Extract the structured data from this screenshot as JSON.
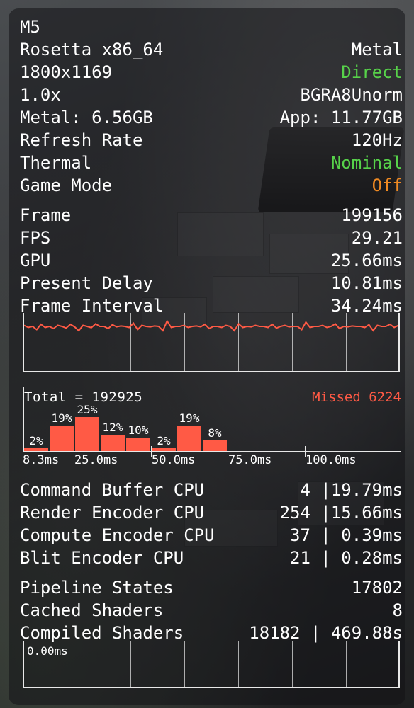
{
  "hud": {
    "device": "M5",
    "translation": "Rosetta x86_64",
    "api": "Metal",
    "resolution": "1800x1169",
    "display_mode": "Direct",
    "scale": "1.0x",
    "pixel_format": "BGRA8Unorm",
    "metal_memory": "Metal: 6.56GB",
    "app_memory": "App: 11.77GB",
    "refresh_label": "Refresh Rate",
    "refresh_value": "120Hz",
    "thermal_label": "Thermal",
    "thermal_value": "Nominal",
    "game_mode_label": "Game Mode",
    "game_mode_value": "Off"
  },
  "stats": {
    "frame_label": "Frame",
    "frame_value": "199156",
    "fps_label": "FPS",
    "fps_value": "29.21",
    "gpu_label": "GPU",
    "gpu_value": "25.66ms",
    "present_label": "Present Delay",
    "present_value": "10.81ms",
    "interval_label": "Frame Interval",
    "interval_value": "34.24ms"
  },
  "histogram": {
    "total": "Total = 192925",
    "missed": "Missed 6224",
    "bars": [
      {
        "label": "2%",
        "value": 2
      },
      {
        "label": "19%",
        "value": 19
      },
      {
        "label": "25%",
        "value": 25
      },
      {
        "label": "12%",
        "value": 12
      },
      {
        "label": "10%",
        "value": 10
      },
      {
        "label": "2%",
        "value": 2
      },
      {
        "label": "19%",
        "value": 19
      },
      {
        "label": "8%",
        "value": 8
      }
    ],
    "ticks": [
      "8.3ms",
      "25.0ms",
      "50.0ms",
      "75.0ms",
      "100.0ms"
    ]
  },
  "encoders": [
    {
      "name": "Command Buffer CPU",
      "count": "4",
      "sep": "|",
      "time": "19.79ms"
    },
    {
      "name": "Render Encoder CPU",
      "count": "254",
      "sep": "|",
      "time": "15.66ms"
    },
    {
      "name": "Compute Encoder CPU",
      "count": "37",
      "sep": "|",
      "time": " 0.39ms"
    },
    {
      "name": "Blit Encoder CPU",
      "count": "21",
      "sep": "|",
      "time": " 0.28ms"
    }
  ],
  "shaders": {
    "pipeline_label": "Pipeline States",
    "pipeline_value": "17802",
    "cached_label": "Cached Shaders",
    "cached_value": "8",
    "compiled_label": "Compiled Shaders",
    "compiled_value": "18182 | 469.88s"
  },
  "bottom_graph": {
    "label": "0.00ms"
  },
  "frame_interval_series": [
    0.55,
    0.45,
    0.5,
    0.35,
    0.6,
    0.45,
    0.5,
    0.4,
    0.55,
    0.5,
    0.42,
    0.6,
    0.48,
    0.3,
    0.55,
    0.5,
    0.44,
    0.62,
    0.5,
    0.5,
    0.4,
    0.58,
    0.48,
    0.52,
    0.5,
    0.45,
    0.65,
    0.35,
    0.55,
    0.5,
    0.48,
    0.52,
    0.5,
    0.3,
    0.75,
    0.45,
    0.5,
    0.5,
    0.55,
    0.45,
    0.5,
    0.52,
    0.48,
    0.6,
    0.4,
    0.5,
    0.5,
    0.45,
    0.55,
    0.5,
    0.3,
    0.62,
    0.45,
    0.5,
    0.48,
    0.55,
    0.5,
    0.5,
    0.45,
    0.6,
    0.42,
    0.5,
    0.55,
    0.48,
    0.5,
    0.5,
    0.35,
    0.7,
    0.45,
    0.5,
    0.5,
    0.55,
    0.45,
    0.5,
    0.62,
    0.4,
    0.5,
    0.48,
    0.52,
    0.5,
    0.5,
    0.45,
    0.58,
    0.3,
    0.55,
    0.5,
    0.5,
    0.6,
    0.45,
    0.55
  ],
  "colors": {
    "good": "#57d24a",
    "warn": "#f08a22",
    "bar": "#ff5a45",
    "line": "#ff5a45"
  }
}
